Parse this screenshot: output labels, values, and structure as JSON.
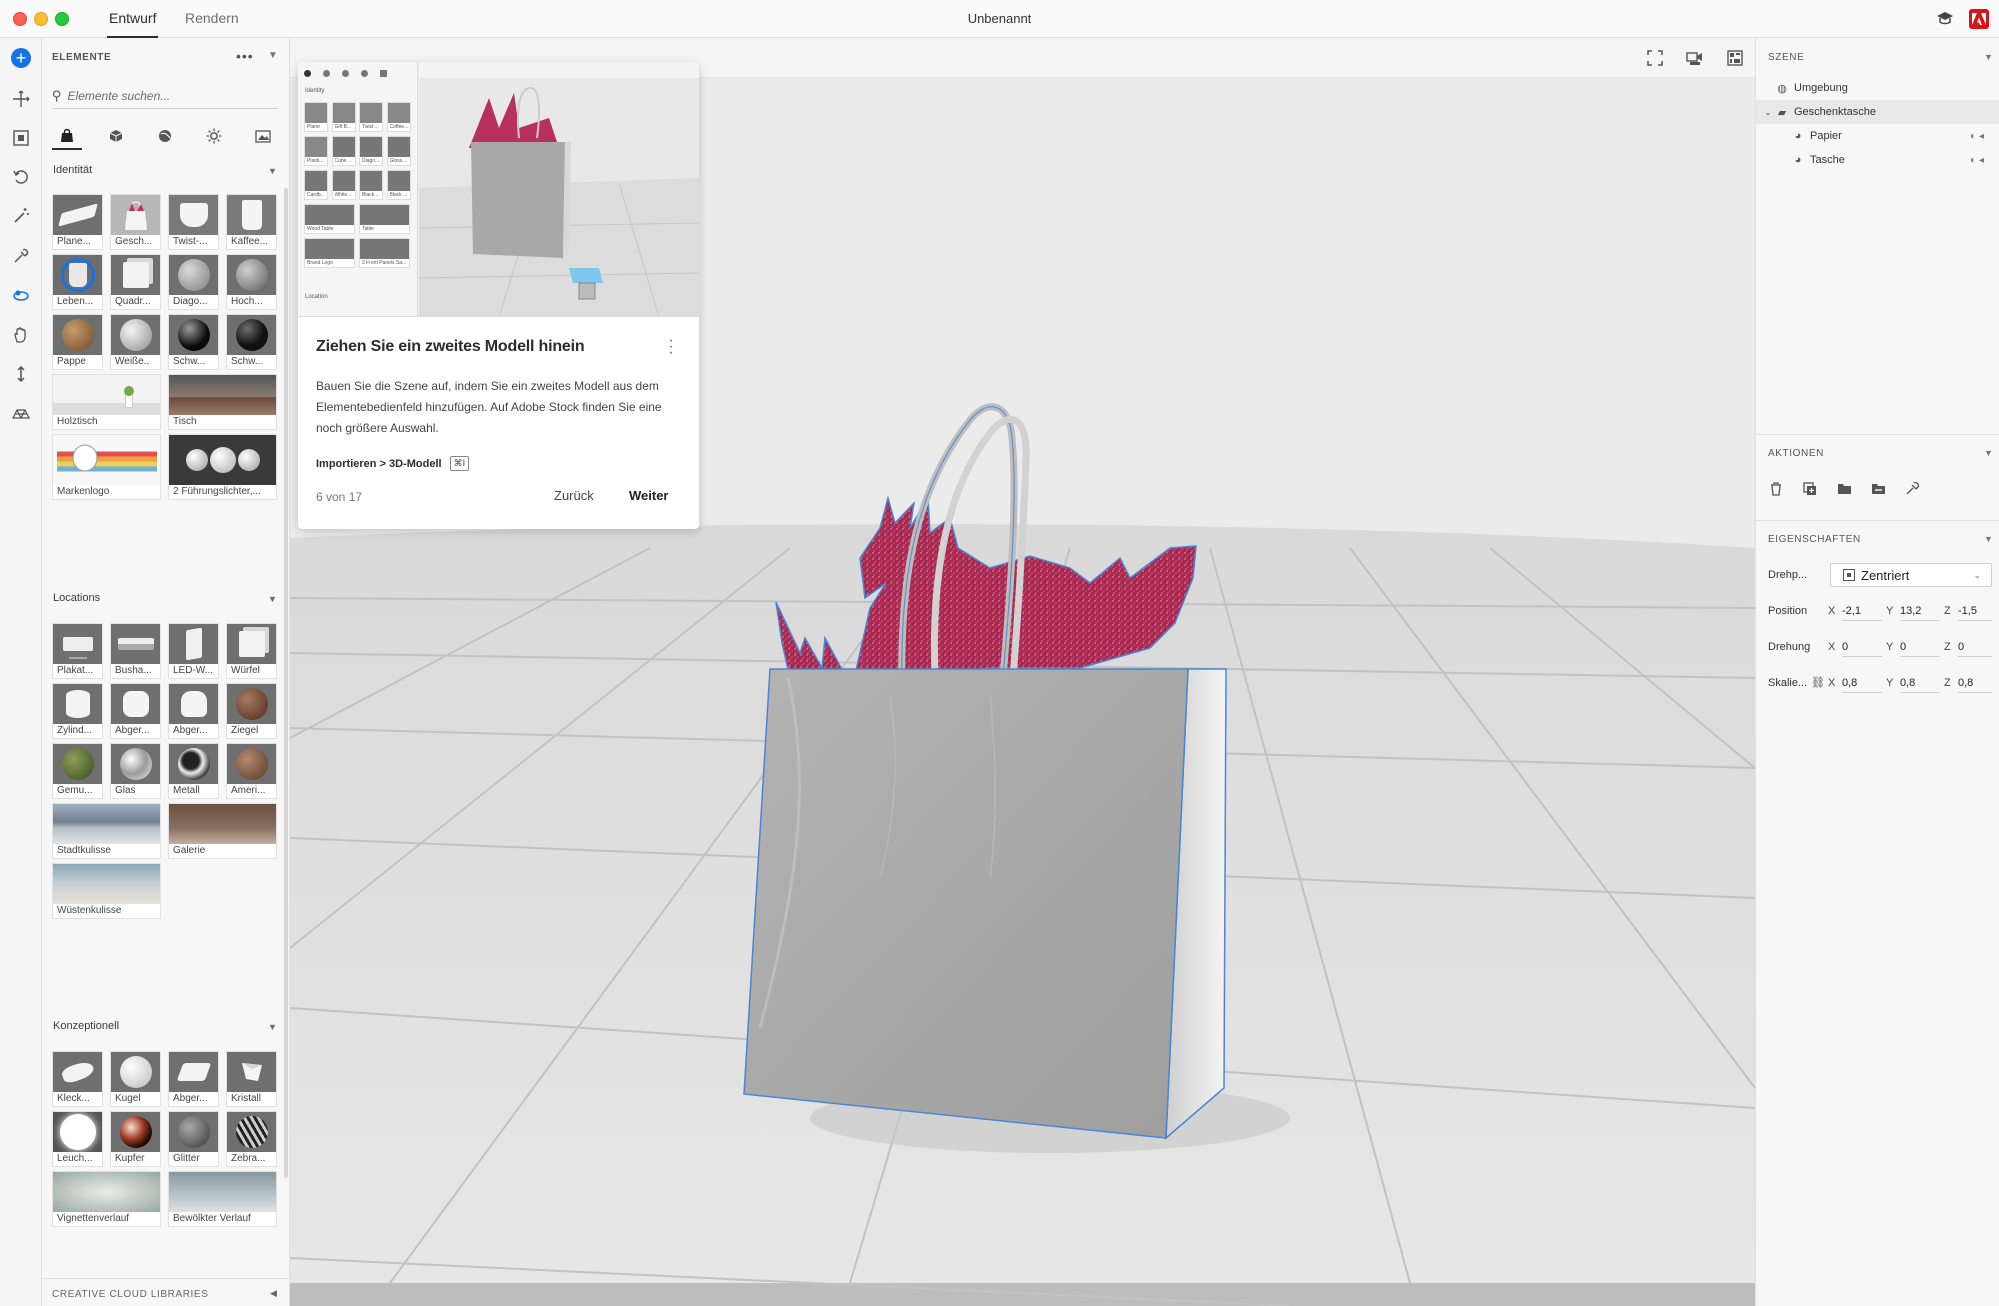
{
  "window": {
    "title": "Unbenannt",
    "tabs": [
      {
        "label": "Entwurf",
        "active": true
      },
      {
        "label": "Rendern",
        "active": false
      }
    ]
  },
  "elements_panel": {
    "title": "ELEMENTE",
    "search_placeholder": "Elemente suchen...",
    "sections": [
      {
        "label": "Identität",
        "items": [
          "Plane...",
          "Gesch...",
          "Twist-...",
          "Kaffee...",
          "Leben...",
          "Quadr...",
          "Diago...",
          "Hoch...",
          "Pappe",
          "Weiße..",
          "Schw...",
          "Schw...",
          "Holztisch",
          "Tisch",
          "Markenlogo",
          "2 Führungslichter,..."
        ]
      },
      {
        "label": "Locations",
        "items": [
          "Plakat...",
          "Busha...",
          "LED-W...",
          "Würfel",
          "Zylind...",
          "Abger...",
          "Abger...",
          "Ziegel",
          "Gemu...",
          "Glas",
          "Metall",
          "Ameri...",
          "Stadtkulisse",
          "Galerie",
          "Wüstenkulisse"
        ]
      },
      {
        "label": "Konzeptionell",
        "items": [
          "Kleck...",
          "Kugel",
          "Abger...",
          "Kristall",
          "Leuch...",
          "Kupfer",
          "Glitter",
          "Zebra...",
          "Vignettenverlauf",
          "Bewölkter Verlauf"
        ]
      }
    ],
    "footer": "CREATIVE CLOUD LIBRARIES"
  },
  "coachmark": {
    "title": "Ziehen Sie ein zweites Modell hinein",
    "body": "Bauen Sie die Szene auf, indem Sie ein zweites Modell aus dem Elementebedienfeld hinzufügen. Auf Adobe Stock finden Sie eine noch größere Auswahl.",
    "path": "Importieren > 3D-Modell",
    "kbd": "⌘I",
    "step": "6 von 17",
    "back_label": "Zurück",
    "next_label": "Weiter",
    "preview": {
      "section": "Identity",
      "items": [
        "Plane",
        "Gift B...",
        "Twist ...",
        "Coffee...",
        "Plasti...",
        "Cube ...",
        "Diago...",
        "Gloss...",
        "Cardb...",
        "White...",
        "Black ...",
        "Black ...",
        "Wood Table",
        "Table",
        "Brand Logo",
        "2 Front Panels Sa..."
      ],
      "section2": "Location"
    }
  },
  "scene_panel": {
    "title": "SZENE",
    "items": [
      {
        "label": "Umgebung",
        "level": 0
      },
      {
        "label": "Geschenktasche",
        "level": 0,
        "selected": true
      },
      {
        "label": "Papier",
        "level": 1
      },
      {
        "label": "Tasche",
        "level": 1
      }
    ]
  },
  "actions_panel": {
    "title": "AKTIONEN"
  },
  "properties_panel": {
    "title": "EIGENSCHAFTEN",
    "pivot_label": "Drehp...",
    "pivot_value": "Zentriert",
    "axes": [
      "X",
      "Y",
      "Z"
    ],
    "rows": [
      {
        "label": "Position",
        "x": "-2,1",
        "y": "13,2",
        "z": "-1,5"
      },
      {
        "label": "Drehung",
        "x": "0",
        "y": "0",
        "z": "0"
      },
      {
        "label": "Skalie...",
        "x": "0,8",
        "y": "0,8",
        "z": "0,8"
      }
    ]
  },
  "colors": {
    "accent": "#1473e6",
    "selection_outline": "#4a86d4",
    "tissue": "#b8305e",
    "bag": "#a9a9a9"
  }
}
